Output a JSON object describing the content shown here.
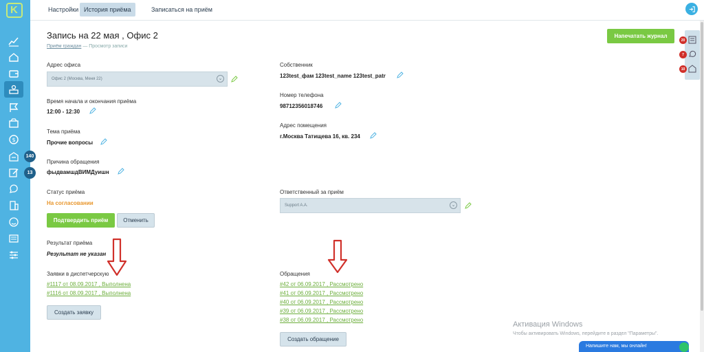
{
  "topbar": {
    "tabs": [
      {
        "label": "Настройки"
      },
      {
        "label": "История приёма"
      },
      {
        "label": "Записаться на приём"
      }
    ]
  },
  "sidebar": {
    "badges": [
      "140",
      "13"
    ]
  },
  "header": {
    "title": "Запись на 22 мая , Офис 2",
    "breadcrumb_link": "Приём граждан",
    "breadcrumb_current": "— Просмотр записи",
    "print_label": "Напечатать журнал"
  },
  "left": {
    "office_label": "Адрес офиса",
    "office_value": "Офис 2 (Москва, Меня 22)",
    "time_label": "Время начала и окончания приёма",
    "time_value": "12:00 - 12:30",
    "topic_label": "Тема приёма",
    "topic_value": "Прочие вопросы",
    "reason_label": "Причина обращения",
    "reason_value": "фыдвамшдВИМДуишн",
    "status_label": "Статус приёма",
    "status_value": "На согласовании",
    "confirm_label": "Подтвердить приём",
    "cancel_label": "Отменить",
    "result_label": "Результат приёма",
    "result_value": "Результат не указан",
    "requests_label": "Заявки в диспетчерскую",
    "requests": [
      "#1117 от 08.09.2017 , Выполнена",
      "#1116 от 08.09.2017 , Выполнена"
    ],
    "create_request_label": "Создать заявку"
  },
  "right": {
    "owner_label": "Собственник",
    "owner_value": "123test_фам 123test_name 123test_patr",
    "phone_label": "Номер телефона",
    "phone_value": "98712356018746",
    "address_label": "Адрес помещения",
    "address_value": "г.Москва Татищева 16, кв. 234",
    "responsible_label": "Ответственный за приём",
    "responsible_value": "Support A.A.",
    "appeals_label": "Обращения",
    "appeals": [
      "#42 от 06.09.2017 , Рассмотрено",
      "#41 от 06.09.2017 , Рассмотрено",
      "#40 от 06.09.2017 , Рассмотрено",
      "#39 от 06.09.2017 , Рассмотрено",
      "#38 от 06.09.2017 , Рассмотрено"
    ],
    "create_appeal_label": "Создать обращение"
  },
  "right_panel": {
    "badges": [
      "20",
      "7",
      "10"
    ]
  },
  "watermark": {
    "line1": "Активация Windows",
    "line2": "Чтобы активировать Windows, перейдите в раздел \"Параметры\"."
  },
  "chat": {
    "label": "Напишите нам, мы онлайн!"
  },
  "colors": {
    "sidebar": "#4fb3e2",
    "accent_green": "#7ac943",
    "status_orange": "#e8962c",
    "arrow_red": "#d0302a"
  }
}
